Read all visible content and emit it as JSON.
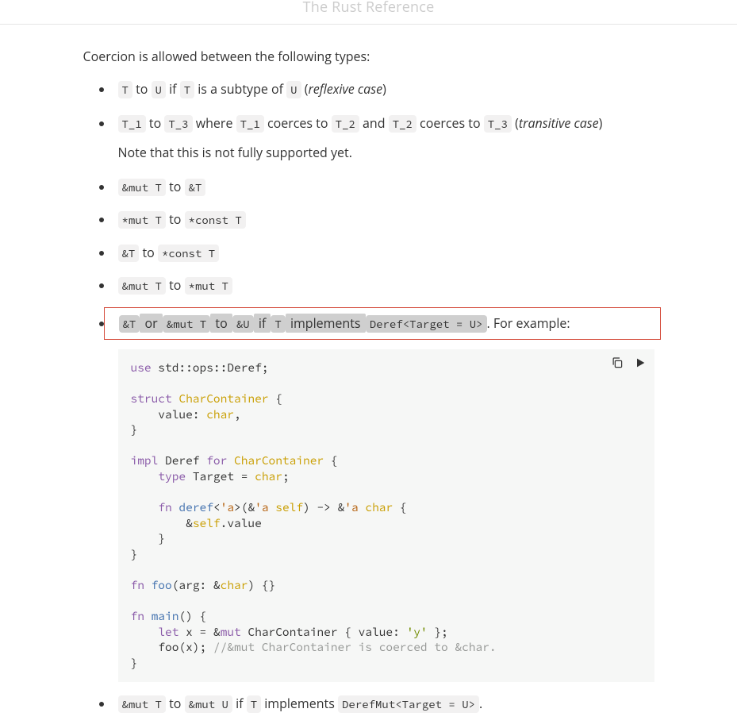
{
  "header": {
    "title": "The Rust Reference"
  },
  "intro": "Coercion is allowed between the following types:",
  "rules": {
    "r1": {
      "c1": "T",
      "t1": " to ",
      "c2": "U",
      "t2": " if ",
      "c3": "T",
      "t3": " is a subtype of ",
      "c4": "U",
      "t4": " (",
      "em": "reflexive case",
      "t5": ")"
    },
    "r2": {
      "c1": "T_1",
      "t1": " to ",
      "c2": "T_3",
      "t2": " where ",
      "c3": "T_1",
      "t3": " coerces to ",
      "c4": "T_2",
      "t4": " and ",
      "c5": "T_2",
      "t5": " coerces to ",
      "c6": "T_3",
      "t6": " (",
      "em": "transitive case",
      "t7": ")",
      "note": "Note that this is not fully supported yet."
    },
    "r3": {
      "c1": "&mut T",
      "t1": " to ",
      "c2": "&T"
    },
    "r4": {
      "c1": "*mut T",
      "t1": " to ",
      "c2": "*const T"
    },
    "r5": {
      "c1": "&T",
      "t1": " to ",
      "c2": "*const T"
    },
    "r6": {
      "c1": "&mut T",
      "t1": " to ",
      "c2": "*mut T"
    },
    "r7": {
      "c1": "&T",
      "t1": " or ",
      "c2": "&mut T",
      "t2": " to ",
      "c3": "&U",
      "t3": " if ",
      "c4": "T",
      "t4": " implements ",
      "c5": "Deref<Target = U>",
      "t5": ". For example:"
    },
    "r8": {
      "c1": "&mut T",
      "t1": " to ",
      "c2": "&mut U",
      "t2": " if ",
      "c3": "T",
      "t3": " implements ",
      "c4": "DerefMut<Target = U>",
      "t4": "."
    }
  },
  "code": {
    "l1_use": "use",
    "l1_rest": " std::ops::Deref;",
    "l2_struct": "struct",
    "l2_name": " CharContainer",
    "l2_open": " {",
    "l3_field": "    value: ",
    "l3_ty": "char",
    "l3_comma": ",",
    "l4_close": "}",
    "l5_impl": "impl",
    "l5_mid": " Deref ",
    "l5_for": "for",
    "l5_name": " CharContainer",
    "l5_open": " {",
    "l6_indent": "    ",
    "l6_type": "type",
    "l6_mid": " Target = ",
    "l6_ty": "char",
    "l6_semi": ";",
    "l7_indent": "    ",
    "l7_fn": "fn",
    "l7_name": " deref",
    "l7_lt_open": "<",
    "l7_lt": "'a",
    "l7_lt_close": ">",
    "l7_paren_open": "(",
    "l7_amp": "&",
    "l7_lt2": "'a",
    "l7_space": " ",
    "l7_self": "self",
    "l7_paren_close": ")",
    "l7_arrow": " -> ",
    "l7_amp2": "&",
    "l7_lt3": "'a",
    "l7_space2": " ",
    "l7_ty": "char",
    "l7_open": " {",
    "l8_indent": "        ",
    "l8_amp": "&",
    "l8_self": "self",
    "l8_dot": ".value",
    "l9_close": "    }",
    "l10_close": "}",
    "l11_fn": "fn",
    "l11_name": " foo",
    "l11_open_p": "(",
    "l11_arg": "arg: ",
    "l11_amp": "&",
    "l11_ty": "char",
    "l11_close_p": ")",
    "l11_body": " {}",
    "l12_fn": "fn",
    "l12_name": " main",
    "l12_sig": "() {",
    "l13_indent": "    ",
    "l13_let": "let",
    "l13_mid": " x = ",
    "l13_amp": "&",
    "l13_mut": "mut",
    "l13_name": " CharContainer { value: ",
    "l13_lit": "'y'",
    "l13_end": " };",
    "l14_indent": "    foo(x); ",
    "l14_comment": "//&mut CharContainer is coerced to &char.",
    "l15_close": "}"
  },
  "icons": {
    "copy": "copy-icon",
    "run": "run-icon"
  }
}
